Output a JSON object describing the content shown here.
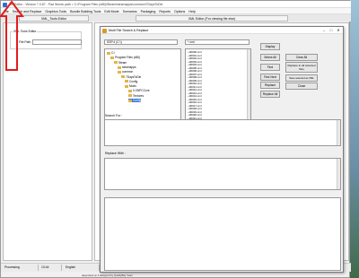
{
  "app": {
    "title": "XmlEditor - Version 7.0.87 - Pad Words path = C:\\Program Files (x86)\\Steam\\steamapps\\common\\7DaysToDie",
    "menu": [
      "File",
      "Search and Replace",
      "Graphics Tools",
      "Bundle Building Tools",
      "Edit Mode",
      "Scenarios",
      "Packaging",
      "Reports",
      "Options",
      "Help"
    ],
    "tabs": {
      "left": "XML_Tools Editor",
      "right": "XML Editor (For viewing file else)"
    },
    "group_label": "XML Tools Editor",
    "file_label": "File Path",
    "status": {
      "left": "Processing",
      "mid": "13:44",
      "right": "English"
    },
    "footer": "dependent on it  designed by QualityBay Team"
  },
  "dialog": {
    "title": "Multi File Search & Replace",
    "drive": "SSP.4 (C:\\)",
    "filter": "*.xml",
    "tree": [
      {
        "label": "C:\\",
        "level": 0,
        "selected": false
      },
      {
        "label": "Program Files (x86)",
        "level": 1,
        "selected": false
      },
      {
        "label": "Steam",
        "level": 2,
        "selected": false
      },
      {
        "label": "steamapps",
        "level": 3,
        "selected": false
      },
      {
        "label": "common",
        "level": 3,
        "selected": false
      },
      {
        "label": "7DaysToDie",
        "level": 4,
        "selected": false
      },
      {
        "label": "Config",
        "level": 5,
        "selected": false
      },
      {
        "label": "Mods",
        "level": 5,
        "selected": false
      },
      {
        "label": "0-XNPCCore",
        "level": 6,
        "selected": false
      },
      {
        "label": "Textures",
        "level": 6,
        "selected": false
      },
      {
        "label": "Config",
        "level": 6,
        "selected": true
      }
    ],
    "files": [
      "~00000.xml",
      "~00001.xml",
      "~00002.xml",
      "~00003.xml",
      "~00004.xml",
      "~00005.xml",
      "~00006.xml",
      "~00007.xml",
      "~00008.xml",
      "~00009.xml",
      "~00010.xml",
      "~00011.xml",
      "~00012.xml",
      "~00013.xml",
      "~00014.xml",
      "~00015.xml",
      "~00016.xml",
      "~00017.xml",
      "~00018.xml",
      "~00019.xml",
      "~00020.xml",
      "~00021.xml"
    ],
    "buttons": {
      "display": "Display",
      "clear_all": "Clear All",
      "select_all": "Select All",
      "replace_all_selected": "Replace in all selected files",
      "find": "Find",
      "save_selected": "Save selected as XML",
      "find_next": "Find Next",
      "close": "Close",
      "replace": "Replace",
      "replace_all": "Replace All"
    },
    "search_for_label": "Search For :",
    "replace_with_label": "Replace With :"
  }
}
